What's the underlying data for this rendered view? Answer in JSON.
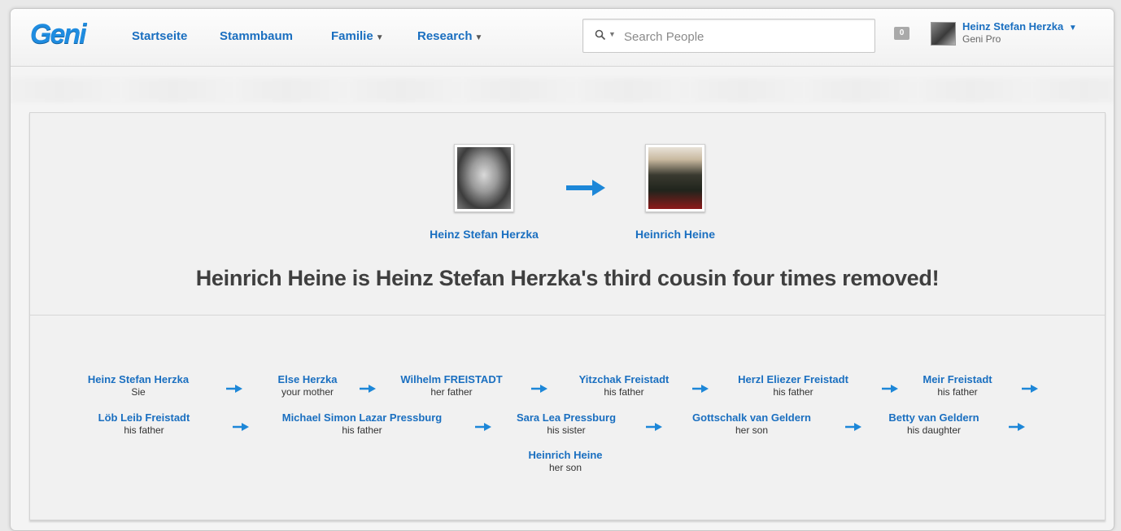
{
  "header": {
    "logo": "Geni",
    "nav": [
      {
        "label": "Startseite",
        "dropdown": false
      },
      {
        "label": "Stammbaum",
        "dropdown": false
      },
      {
        "label": "Familie",
        "dropdown": true
      },
      {
        "label": "Research",
        "dropdown": true
      }
    ],
    "search_placeholder": "Search People",
    "notifications_count": "0",
    "user_name": "Heinz Stefan Herzka",
    "user_plan": "Geni Pro"
  },
  "relationship": {
    "person_a": "Heinz Stefan Herzka",
    "person_b": "Heinrich Heine",
    "headline": "Heinrich Heine is Heinz Stefan Herzka's third cousin four times removed!"
  },
  "path": [
    {
      "name": "Heinz Stefan Herzka",
      "relation": "Sie"
    },
    {
      "name": "Else Herzka",
      "relation": "your mother"
    },
    {
      "name": "Wilhelm FREISTADT",
      "relation": "her father"
    },
    {
      "name": "Yitzchak Freistadt",
      "relation": "his father"
    },
    {
      "name": "Herzl Eliezer Freistadt",
      "relation": "his father"
    },
    {
      "name": "Meir Freistadt",
      "relation": "his father"
    },
    {
      "name": "Löb Leib Freistadt",
      "relation": "his father"
    },
    {
      "name": "Michael Simon Lazar Pressburg",
      "relation": "his father"
    },
    {
      "name": "Sara Lea Pressburg",
      "relation": "his sister"
    },
    {
      "name": "Gottschalk van Geldern",
      "relation": "her son"
    },
    {
      "name": "Betty van Geldern",
      "relation": "his daughter"
    },
    {
      "name": "Heinrich Heine",
      "relation": "her son"
    }
  ],
  "colors": {
    "link": "#1a6fc0",
    "arrow": "#1d87d8",
    "headline": "#3f3f3f"
  }
}
